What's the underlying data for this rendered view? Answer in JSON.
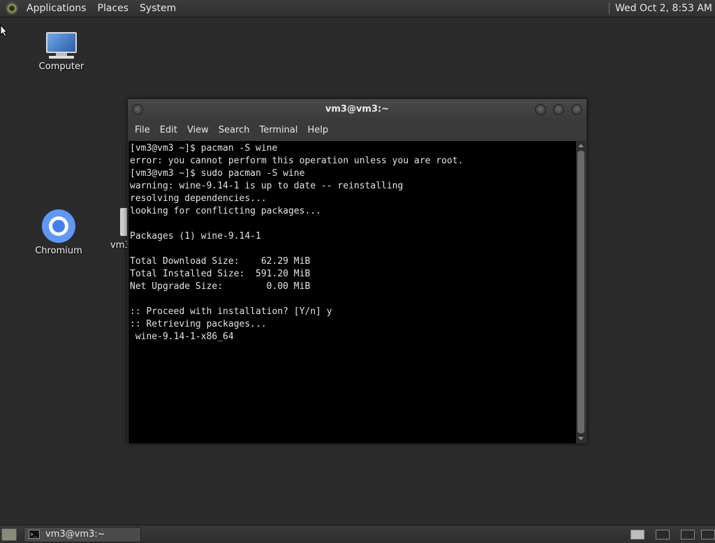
{
  "top_panel": {
    "menus": [
      "Applications",
      "Places",
      "System"
    ],
    "clock": "Wed Oct  2,  8:53 AM"
  },
  "desktop": {
    "icons": [
      {
        "label": "Computer",
        "icon": "computer-icon"
      },
      {
        "label": "Chromium",
        "icon": "chromium-icon"
      },
      {
        "label": "vm3",
        "icon": "folder-icon"
      }
    ]
  },
  "terminal": {
    "title": "vm3@vm3:~",
    "menu": [
      "File",
      "Edit",
      "View",
      "Search",
      "Terminal",
      "Help"
    ],
    "lines": [
      "[vm3@vm3 ~]$ pacman -S wine",
      "error: you cannot perform this operation unless you are root.",
      "[vm3@vm3 ~]$ sudo pacman -S wine",
      "warning: wine-9.14-1 is up to date -- reinstalling",
      "resolving dependencies...",
      "looking for conflicting packages...",
      "",
      "Packages (1) wine-9.14-1",
      "",
      "Total Download Size:    62.29 MiB",
      "Total Installed Size:  591.20 MiB",
      "Net Upgrade Size:        0.00 MiB",
      "",
      ":: Proceed with installation? [Y/n] y",
      ":: Retrieving packages...",
      " wine-9.14-1-x86_64"
    ]
  },
  "taskbar": {
    "task_label": "vm3@vm3:~",
    "task_icon_text": ">_"
  }
}
